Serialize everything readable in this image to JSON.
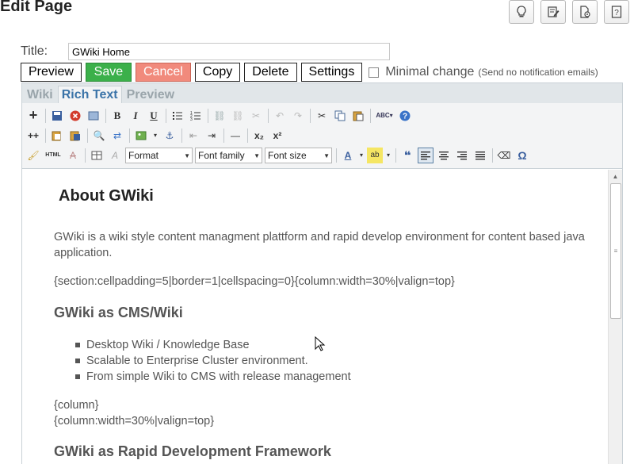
{
  "page": {
    "title": "Edit Page"
  },
  "top_icons": [
    {
      "name": "lightbulb-icon",
      "glyph": "💡"
    },
    {
      "name": "edit-note-icon",
      "glyph": "📝"
    },
    {
      "name": "page-settings-icon",
      "glyph": "🗎"
    },
    {
      "name": "help-icon",
      "glyph": "?"
    }
  ],
  "title_field": {
    "label": "Title:",
    "value": "GWiki Home"
  },
  "buttons": {
    "preview": "Preview",
    "save": "Save",
    "cancel": "Cancel",
    "copy": "Copy",
    "delete": "Delete",
    "settings": "Settings"
  },
  "minimal_change": {
    "label": "Minimal change",
    "note": "(Send no notification emails)",
    "checked": false
  },
  "tabs": [
    {
      "label": "Wiki",
      "active": false
    },
    {
      "label": "Rich Text",
      "active": true
    },
    {
      "label": "Preview",
      "active": false
    }
  ],
  "toolbar": {
    "format_select": "Format",
    "font_family_select": "Font family",
    "font_size_select": "Font size",
    "row1_glyphs": [
      "+",
      "💾",
      "✖",
      "▣",
      "B",
      "I",
      "U",
      "☰",
      "☷",
      "🔗",
      "⛓",
      "✂",
      "↶",
      "↷",
      "✂",
      "⎘",
      "📋",
      "ABC",
      "?"
    ],
    "row2_glyphs": [
      "++",
      "📋",
      "📋",
      "🔍",
      "⇄",
      "🖼",
      "⚓",
      "⇤",
      "⇥",
      "—",
      "x₂",
      "x²"
    ],
    "row3_glyphs": [
      "🖌",
      "HTML",
      "A",
      "▦",
      "A",
      "A",
      "ab",
      "❝",
      "≡",
      "≡",
      "≡",
      "≡",
      "⌫",
      "Ω"
    ]
  },
  "content": {
    "heading": "About GWiki",
    "intro": "GWiki is a wiki style content managment plattform and rapid develop environment for content based java application.",
    "section_macro": "{section:cellpadding=5|border=1|cellspacing=0}{column:width=30%|valign=top}",
    "h_cms": "GWiki as CMS/Wiki",
    "bullets": [
      "Desktop Wiki / Knowledge Base",
      "Scalable to Enterprise Cluster environment.",
      "From simple Wiki to CMS with release management"
    ],
    "column_end": "{column}",
    "column_start": "{column:width=30%|valign=top}",
    "h_rapid": "GWiki as Rapid Development Framework"
  }
}
